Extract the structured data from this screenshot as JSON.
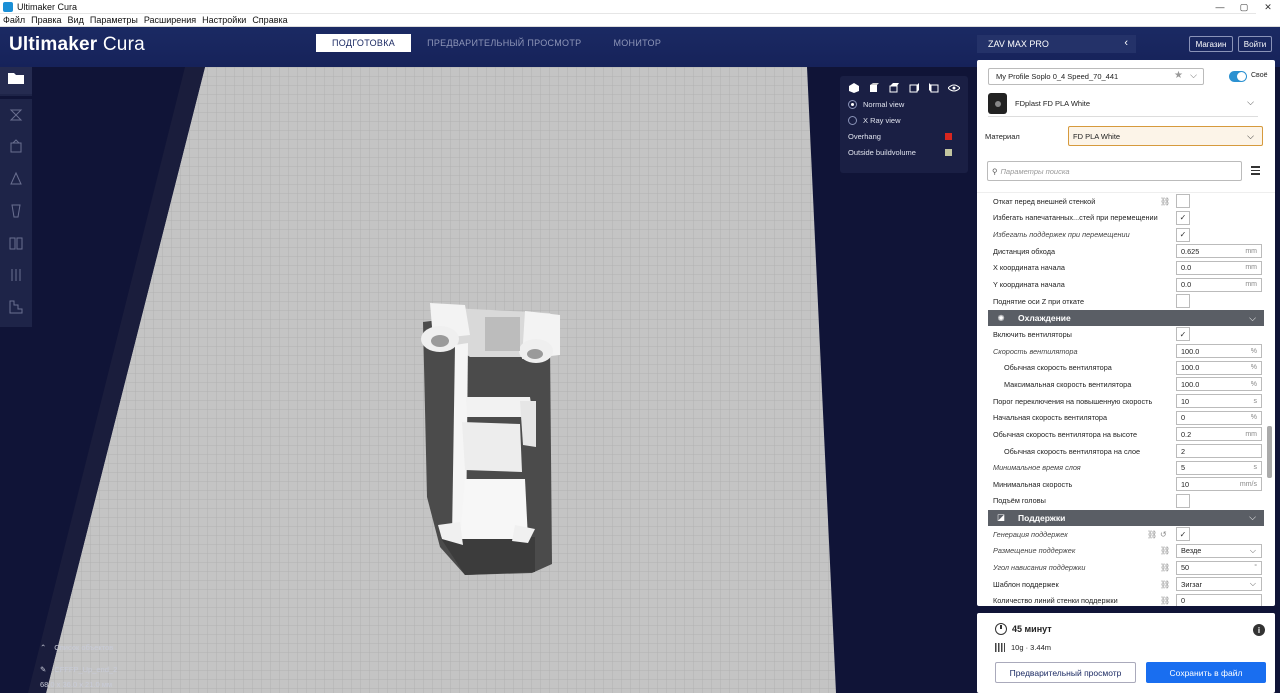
{
  "window": {
    "title": "Ultimaker Cura",
    "controls": [
      "—",
      "▢",
      "✕"
    ]
  },
  "menu": [
    "Файл",
    "Правка",
    "Вид",
    "Параметры",
    "Расширения",
    "Настройки",
    "Справка"
  ],
  "header": {
    "brand_bold": "Ultimaker",
    "brand_light": " Cura",
    "tabs": [
      {
        "label": "ПОДГОТОВКА",
        "active": true
      },
      {
        "label": "ПРЕДВАРИТЕЛЬНЫЙ ПРОСМОТР",
        "active": false
      },
      {
        "label": "МОНИТОР",
        "active": false
      }
    ],
    "printer": "ZAV MAX PRO",
    "marketplace": "Магазин",
    "signin": "Войти"
  },
  "view_panel": {
    "normal_view": "Normal view",
    "xray_view": "X Ray view",
    "overhang": "Overhang",
    "outside_buildvolume": "Outside buildvolume",
    "overhang_color": "#d8261f",
    "outside_color": "#c2c5a0"
  },
  "object_list": {
    "title": "Список объектов",
    "object_name": "CFFFP_Up_end_2",
    "dimensions": "68.0 x 36.0 x 21.0 мм"
  },
  "settings_panel": {
    "profile": "My Profile Soplo 0_4 Speed_70_441",
    "custom_label": "Своё",
    "extruder_material": "FDplast FD PLA White",
    "material_label": "Материал",
    "material_value": "FD PLA White",
    "search_placeholder": "Параметры поиска",
    "rows": [
      {
        "type": "setting",
        "label": "Откат перед внешней стенкой",
        "link": true,
        "control": "checkbox",
        "checked": false
      },
      {
        "type": "setting",
        "label": "Избегать напечатанных...стей при перемещении",
        "control": "checkbox",
        "checked": true
      },
      {
        "type": "setting",
        "label": "Избегать поддержек при перемещении",
        "italic": true,
        "control": "checkbox",
        "checked": true
      },
      {
        "type": "setting",
        "label": "Дистанция обхода",
        "control": "field",
        "value": "0.625",
        "unit": "mm"
      },
      {
        "type": "setting",
        "label": "X координата начала",
        "control": "field",
        "value": "0.0",
        "unit": "mm"
      },
      {
        "type": "setting",
        "label": "Y координата начала",
        "control": "field",
        "value": "0.0",
        "unit": "mm"
      },
      {
        "type": "setting",
        "label": "Поднятие оси Z при откате",
        "control": "checkbox",
        "checked": false
      },
      {
        "type": "category",
        "label": "Охлаждение",
        "icon": "✺"
      },
      {
        "type": "setting",
        "label": "Включить вентиляторы",
        "control": "checkbox",
        "checked": true
      },
      {
        "type": "setting",
        "label": "Скорость вентилятора",
        "italic": true,
        "control": "field",
        "value": "100.0",
        "unit": "%"
      },
      {
        "type": "setting",
        "label": "Обычная скорость вентилятора",
        "indent": true,
        "control": "field",
        "value": "100.0",
        "unit": "%"
      },
      {
        "type": "setting",
        "label": "Максимальная скорость вентилятора",
        "indent": true,
        "control": "field",
        "value": "100.0",
        "unit": "%"
      },
      {
        "type": "setting",
        "label": "Порог переключения на повышенную скорость",
        "control": "field",
        "value": "10",
        "unit": "s"
      },
      {
        "type": "setting",
        "label": "Начальная скорость вентилятора",
        "control": "field",
        "value": "0",
        "unit": "%"
      },
      {
        "type": "setting",
        "label": "Обычная скорость вентилятора на высоте",
        "control": "field",
        "value": "0.2",
        "unit": "mm"
      },
      {
        "type": "setting",
        "label": "Обычная скорость вентилятора на слое",
        "indent": true,
        "control": "field",
        "value": "2",
        "unit": ""
      },
      {
        "type": "setting",
        "label": "Минимальное время слоя",
        "italic": true,
        "control": "field",
        "value": "5",
        "unit": "s"
      },
      {
        "type": "setting",
        "label": "Минимальная скорость",
        "control": "field",
        "value": "10",
        "unit": "mm/s"
      },
      {
        "type": "setting",
        "label": "Подъём головы",
        "control": "checkbox",
        "checked": false
      },
      {
        "type": "category",
        "label": "Поддержки",
        "icon": "◪"
      },
      {
        "type": "setting",
        "label": "Генерация поддержек",
        "italic": true,
        "link": true,
        "reset": true,
        "control": "checkbox",
        "checked": true
      },
      {
        "type": "setting",
        "label": "Размещение поддержек",
        "italic": true,
        "link": true,
        "control": "select",
        "value": "Везде"
      },
      {
        "type": "setting",
        "label": "Угол нависания поддержки",
        "italic": true,
        "link": true,
        "control": "field",
        "value": "50",
        "unit": "°"
      },
      {
        "type": "setting",
        "label": "Шаблон поддержек",
        "link": true,
        "control": "select",
        "value": "Зигзаг"
      },
      {
        "type": "setting",
        "label": "Количество линий стенки поддержки",
        "link": true,
        "control": "field",
        "value": "0",
        "unit": ""
      }
    ]
  },
  "action_panel": {
    "time": "45 минут",
    "material_usage": "10g · 3.44m",
    "preview_button": "Предварительный просмотр",
    "save_button": "Сохранить в файл"
  }
}
